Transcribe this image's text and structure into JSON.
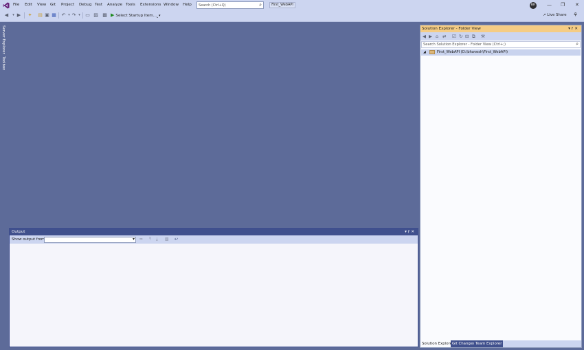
{
  "menu": {
    "items": [
      "File",
      "Edit",
      "View",
      "Git",
      "Project",
      "Debug",
      "Test",
      "Analyze",
      "Tools",
      "Extensions",
      "Window",
      "Help"
    ]
  },
  "search": {
    "placeholder": "Search (Ctrl+Q)"
  },
  "solution_name": "First_WebAPI",
  "user": {
    "initials": "BR"
  },
  "toolbar": {
    "startup_label": "Select Startup Item...",
    "live_share": "Live Share"
  },
  "left_tabs": [
    "Server Explorer",
    "Toolbox"
  ],
  "output": {
    "title": "Output",
    "show_output_label": "Show output from:",
    "selected_source": ""
  },
  "solution_explorer": {
    "title": "Solution Explorer - Folder View",
    "search_placeholder": "Search Solution Explorer - Folder View (Ctrl+;)",
    "root_item": "First_WebAPI (D:\\bhavesh\\First_WebAPI)",
    "tabs": [
      "Solution Explorer",
      "Git Changes",
      "Team Explorer"
    ]
  },
  "icons": {
    "logo": "visual-studio-logo",
    "search": "magnifier-icon",
    "play": "play-icon"
  },
  "colors": {
    "chrome": "#ccd5f0",
    "editor_bg": "#5d6b99",
    "panel_title": "#40508d",
    "active_title": "#f5cc84"
  }
}
